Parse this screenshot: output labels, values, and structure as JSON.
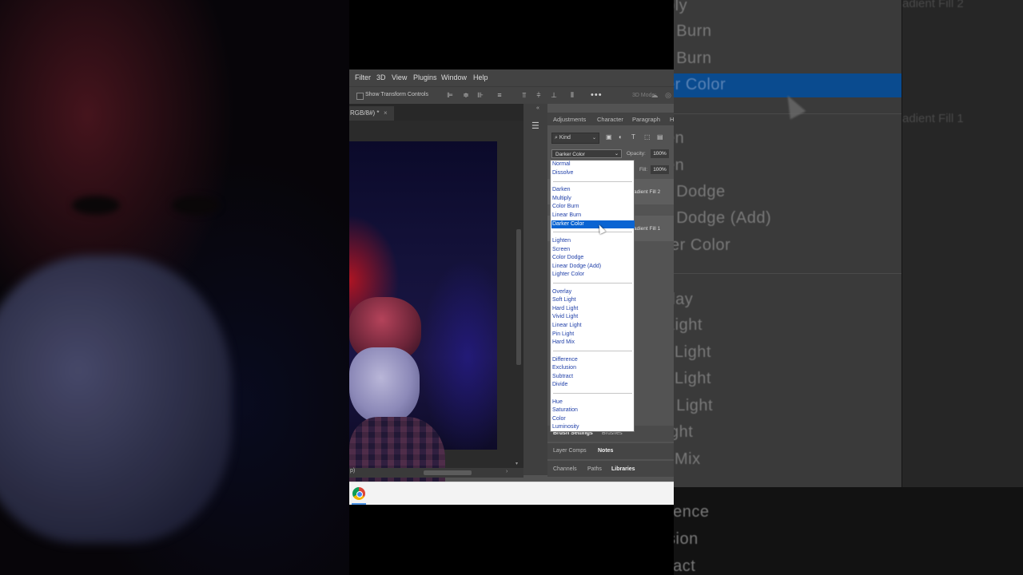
{
  "menubar": {
    "items": [
      "Filter",
      "3D",
      "View",
      "Plugins",
      "Window",
      "Help"
    ]
  },
  "options_bar": {
    "show_transform_controls": "Show Transform Controls",
    "more": "•••",
    "mode_3d": "3D Mode:"
  },
  "document": {
    "tab_title": "RGB/8#) *",
    "tab_close": "×",
    "status": "p)"
  },
  "panel": {
    "tabs": [
      "Adjustments",
      "Character",
      "Paragraph",
      "H"
    ],
    "kind_label": "Kind",
    "blend_mode": "Darker Color",
    "opacity_label": "Opacity:",
    "opacity_value": "100%",
    "fill_label": "Fill:",
    "fill_value": "100%",
    "layers": [
      "adient Fill 2",
      "adient Fill 1"
    ],
    "lower_tabs": {
      "row1": [
        "Brush Settings",
        "Brushes"
      ],
      "row2": [
        "Layer Comps",
        "Notes"
      ],
      "row3": [
        "Channels",
        "Paths",
        "Libraries"
      ]
    }
  },
  "blend_dropdown": {
    "groups": [
      [
        "Normal",
        "Dissolve"
      ],
      [
        "Darken",
        "Multiply",
        "Color Burn",
        "Linear Burn",
        "Darker Color"
      ],
      [
        "Lighten",
        "Screen",
        "Color Dodge",
        "Linear Dodge (Add)",
        "Lighter Color"
      ],
      [
        "Overlay",
        "Soft Light",
        "Hard Light",
        "Vivid Light",
        "Linear Light",
        "Pin Light",
        "Hard Mix"
      ],
      [
        "Difference",
        "Exclusion",
        "Subtract",
        "Divide"
      ],
      [
        "Hue",
        "Saturation",
        "Color",
        "Luminosity"
      ]
    ],
    "selected": "Darker Color"
  },
  "zoomed_backdrop": {
    "items": [
      "ply",
      "r Burn",
      "r Burn",
      "er Color",
      "en",
      "en",
      "r Dodge",
      "r Dodge (Add)",
      "ter Color",
      "rlay",
      "Light",
      "l Light",
      "l Light",
      "r Light",
      "ight",
      "l Mix",
      "rence",
      "sion",
      "ract"
    ],
    "layer_labels": [
      "adient Fill 2",
      "adient Fill 1"
    ]
  },
  "taskbar": {
    "app": "chrome"
  },
  "colors": {
    "selection": "#0a64d2",
    "menu_text": "#1f3fa8",
    "panel_bg": "#535353"
  }
}
